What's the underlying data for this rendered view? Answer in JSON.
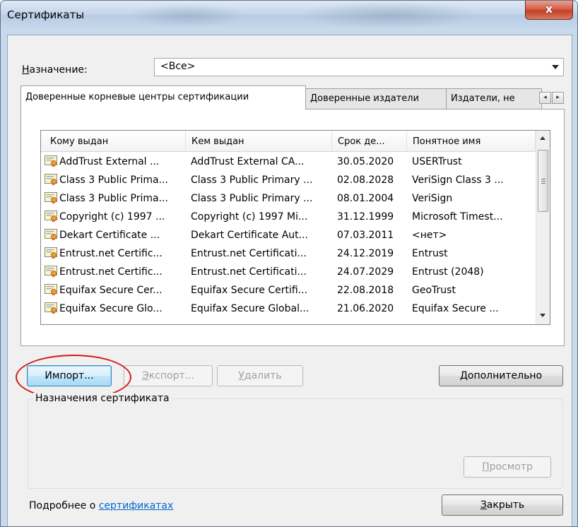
{
  "window": {
    "title": "Сертификаты",
    "close_label": "x"
  },
  "purpose": {
    "label_underlined": "Н",
    "label_rest": "азначение:",
    "value": "<Все>"
  },
  "tabs": [
    {
      "label": "Доверенные корневые центры сертификации",
      "active": true
    },
    {
      "label": "Доверенные издатели",
      "active": false
    },
    {
      "label": "Издатели, не",
      "active": false
    }
  ],
  "tab_scroll": {
    "left": "◂",
    "right": "▸"
  },
  "list": {
    "columns": [
      "Кому выдан",
      "Кем выдан",
      "Срок де...",
      "Понятное имя"
    ],
    "rows": [
      [
        "AddTrust External ...",
        "AddTrust External CA...",
        "30.05.2020",
        "USERTrust"
      ],
      [
        "Class 3 Public Prima...",
        "Class 3 Public Primary ...",
        "02.08.2028",
        "VeriSign Class 3 ..."
      ],
      [
        "Class 3 Public Prima...",
        "Class 3 Public Primary ...",
        "08.01.2004",
        "VeriSign"
      ],
      [
        "Copyright (c) 1997 ...",
        "Copyright (c) 1997 Mi...",
        "31.12.1999",
        "Microsoft Timest..."
      ],
      [
        "Dekart Certificate ...",
        "Dekart Certificate Aut...",
        "07.03.2011",
        "<нет>"
      ],
      [
        "Entrust.net Certific...",
        "Entrust.net Certificati...",
        "24.12.2019",
        "Entrust"
      ],
      [
        "Entrust.net Certific...",
        "Entrust.net Certificati...",
        "24.07.2029",
        "Entrust (2048)"
      ],
      [
        "Equifax Secure Cer...",
        "Equifax Secure Certifi...",
        "22.08.2018",
        "GeoTrust"
      ],
      [
        "Equifax Secure Glo...",
        "Equifax Secure Global...",
        "21.06.2020",
        "Equifax Secure ..."
      ]
    ],
    "row_icon": "certificate-icon"
  },
  "buttons": {
    "import": "Импорт...",
    "export_underlined": "Э",
    "export_rest": "кспорт...",
    "delete_underlined": "У",
    "delete_rest": "далить",
    "advanced_underlined": "Д",
    "advanced_rest": "ополнительно",
    "view_underlined": "П",
    "view_rest": "росмотр",
    "close_underlined": "З",
    "close_rest": "акрыть"
  },
  "cert_purposes": {
    "label": "Назначения сертификата"
  },
  "footer": {
    "text": "Подробнее о ",
    "link": "сертификатах"
  },
  "colors": {
    "highlight_ellipse": "#d11a1a",
    "link": "#0066cc",
    "default_button": "#3c7fb1"
  }
}
